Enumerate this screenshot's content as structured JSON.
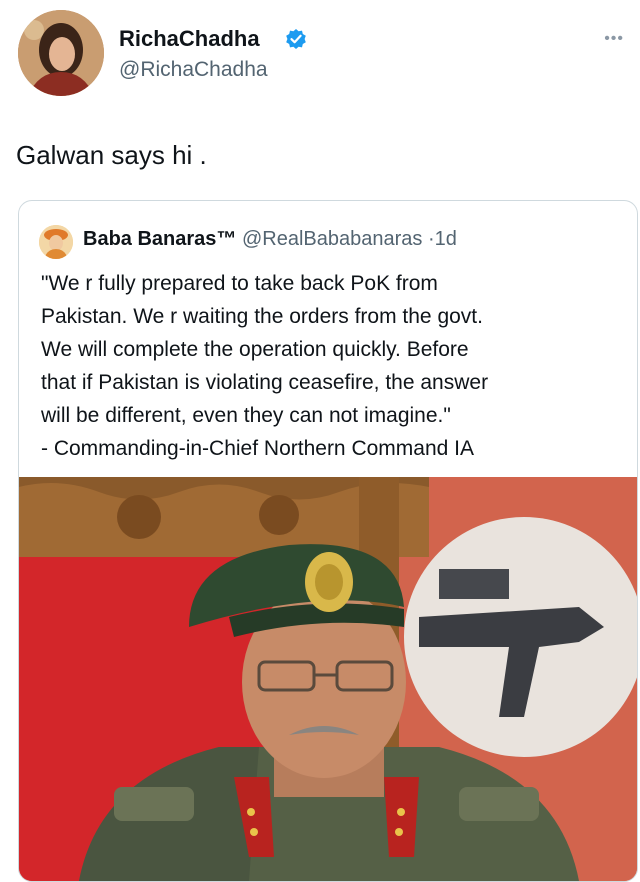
{
  "author": {
    "name": "RichaChadha",
    "handle": "@RichaChadha",
    "verified": true
  },
  "tweet": {
    "text": "Galwan says hi ."
  },
  "quoted": {
    "name": "Baba Banaras™",
    "handle": "@RealBababanaras",
    "separator": "·",
    "time": "1d",
    "lines": [
      "\"We r fully prepared to take back PoK from",
      "Pakistan. We r waiting the orders from the govt.",
      "We will complete the operation quickly. Before",
      "that if Pakistan is violating ceasefire, the answer",
      "will be different, even they can not imagine.\"",
      "- Commanding-in-Chief Northern Command IA"
    ]
  },
  "icons": {
    "verified": "verified-badge-icon",
    "more": "more-options-icon"
  },
  "colors": {
    "verified": "#1d9bf0",
    "text": "#0f1419",
    "muted": "#536471",
    "border": "#cfd9de"
  }
}
